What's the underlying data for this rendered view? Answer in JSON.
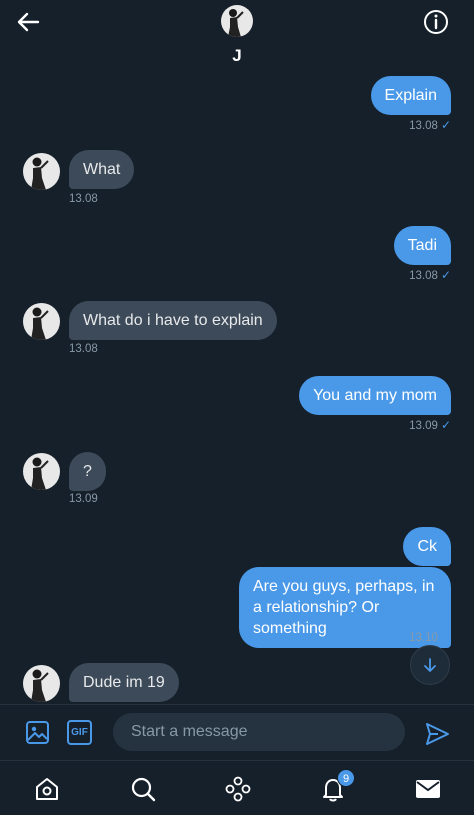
{
  "header": {
    "contact_name": "J"
  },
  "messages": [
    {
      "direction": "out",
      "text": "Explain",
      "time": "13.08"
    },
    {
      "direction": "in",
      "text": "What",
      "time": "13.08"
    },
    {
      "direction": "out",
      "text": "Tadi",
      "time": "13.08"
    },
    {
      "direction": "in",
      "text": "What do i have to explain",
      "time": "13.08"
    },
    {
      "direction": "out",
      "text": "You and my mom",
      "time": "13.09"
    },
    {
      "direction": "in",
      "text": "?",
      "time": "13.09"
    },
    {
      "direction": "out",
      "text": "Ck",
      "time": null
    },
    {
      "direction": "out",
      "text": "Are you guys, perhaps, in a relationship? Or something",
      "time": "13.10"
    },
    {
      "direction": "in",
      "text": "Dude im 19",
      "time": null
    }
  ],
  "read_receipt_icon": "check-icon",
  "composer": {
    "placeholder": "Start a message",
    "gif_label": "GIF"
  },
  "tabbar": {
    "notifications_badge": "9"
  },
  "colors": {
    "background": "#15202b",
    "accent": "#4a99e9",
    "incoming_bubble": "#3d4a59",
    "timestamp": "#8899a6"
  }
}
